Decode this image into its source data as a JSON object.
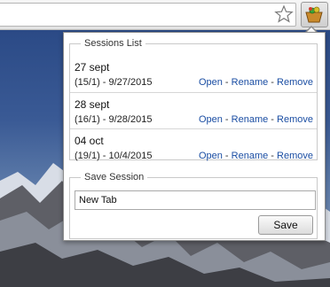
{
  "browser": {
    "star_icon": "star-icon",
    "extension_icon": "sessions-extension-icon"
  },
  "popup": {
    "sessions_legend": "Sessions List",
    "sessions": [
      {
        "name": "27 sept",
        "date": "(15/1) - 9/27/2015"
      },
      {
        "name": "28 sept",
        "date": "(16/1) - 9/28/2015"
      },
      {
        "name": "04 oct",
        "date": "(19/1) - 10/4/2015"
      }
    ],
    "actions": {
      "open": "Open",
      "rename": "Rename",
      "remove": "Remove",
      "separator": "-"
    },
    "save_legend": "Save Session",
    "save_input_value": "New Tab",
    "save_button": "Save"
  },
  "colors": {
    "link": "#1b4ea3"
  }
}
